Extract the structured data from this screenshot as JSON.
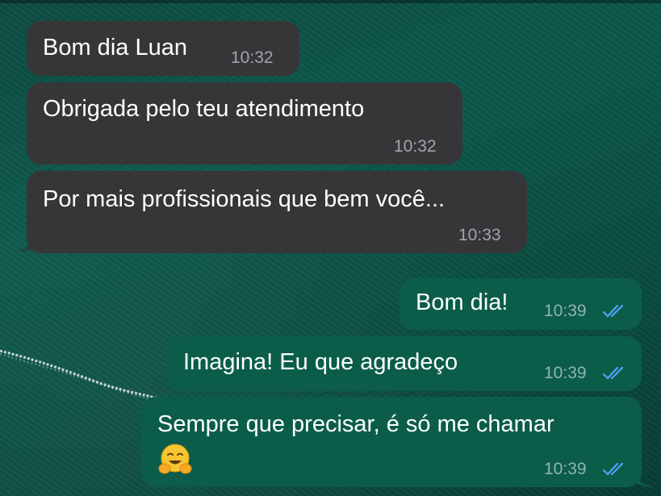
{
  "colors": {
    "incoming_bubble": "#363638",
    "outgoing_bubble": "#0b5d4a",
    "read_receipt": "#4fa3f7",
    "wallpaper": "#0c5a4c"
  },
  "messages": [
    {
      "direction": "incoming",
      "text": "Bom dia Luan",
      "time": "10:32"
    },
    {
      "direction": "incoming",
      "text": "Obrigada pelo teu atendimento",
      "time": "10:32"
    },
    {
      "direction": "incoming",
      "text": "Por mais profissionais que bem você...",
      "time": "10:33"
    },
    {
      "direction": "outgoing",
      "text": "Bom dia!",
      "time": "10:39",
      "status_icon": "double-check-read-icon"
    },
    {
      "direction": "outgoing",
      "text": "Imagina! Eu que agradeço",
      "time": "10:39",
      "status_icon": "double-check-read-icon"
    },
    {
      "direction": "outgoing",
      "text": "Sempre que precisar, é só me chamar",
      "emoji_icon": "hugging-face-emoji-icon",
      "time": "10:39",
      "status_icon": "double-check-read-icon"
    }
  ]
}
